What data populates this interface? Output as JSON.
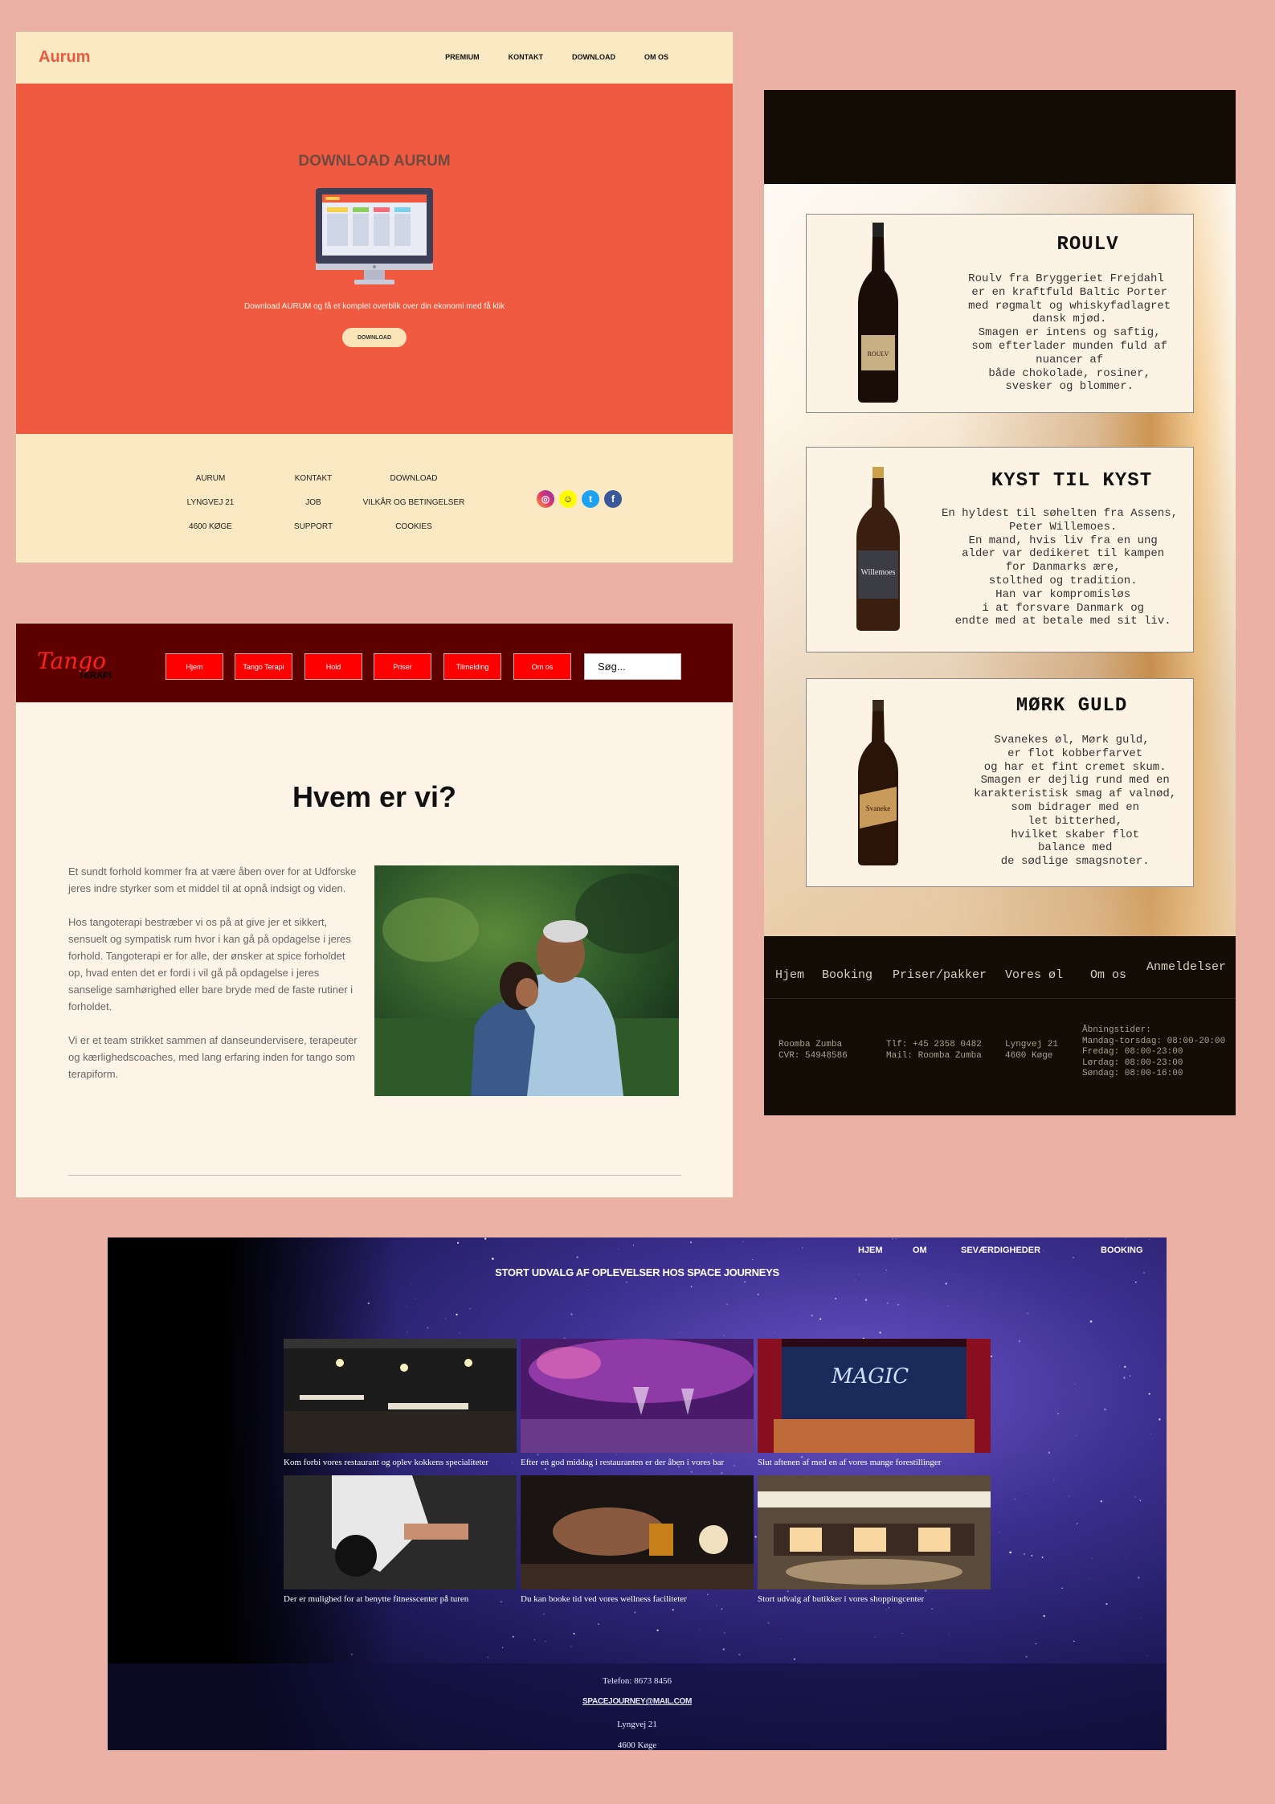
{
  "aurum": {
    "logo": "Aurum",
    "nav": [
      "PREMIUM",
      "KONTAKT",
      "DOWNLOAD",
      "OM OS"
    ],
    "hero_title": "DOWNLOAD AURUM",
    "hero_text": "Download AURUM og få et komplet overblik over din ekonomi med få klik",
    "download_button": "DOWNLOAD",
    "footer": {
      "col1": [
        "AURUM",
        "LYNGVEJ 21",
        "4600 KØGE"
      ],
      "col2": [
        "KONTAKT",
        "JOB",
        "SUPPORT"
      ],
      "col3": [
        "DOWNLOAD",
        "VILKÅR OG BETINGELSER",
        "COOKIES"
      ]
    },
    "social_icons": [
      "instagram-icon",
      "snapchat-icon",
      "twitter-icon",
      "facebook-icon"
    ],
    "colors": {
      "accent": "#ef5a40",
      "cream": "#fbe9c4"
    }
  },
  "beer": {
    "cards": [
      {
        "title": "ROULV",
        "text": "Roulv fra Bryggeriet Frejdahl\n er en kraftfuld Baltic Porter\n med røgmalt og whiskyfadlagret\n dansk mjød.\n Smagen er intens og saftig,\n som efterlader munden fuld af\n nuancer af\n både chokolade, rosiner,\n svesker og blommer."
      },
      {
        "title": "KYST TIL KYST",
        "text": "En hyldest til søhelten fra Assens,\n Peter Willemoes.\n En mand, hvis liv fra en ung\n alder var dedikeret til kampen\n for Danmarks ære,\n stolthed og tradition.\n Han var kompromisløs\n i at forsvare Danmark og\n endte med at betale med sit liv."
      },
      {
        "title": "MØRK GULD",
        "text": "Svanekes øl, Mørk guld,\n er flot kobberfarvet\n og har et fint cremet skum.\n Smagen er dejlig rund med en\n karakteristisk smag af valnød,\n som bidrager med en\n let bitterhed,\n hvilket skaber flot\n balance med\n de sødlige smagsnoter."
      }
    ],
    "bottle_labels": [
      "ROULV",
      "Willemoes",
      "Svaneke"
    ],
    "nav": [
      "Hjem",
      "Booking",
      "Priser/pakker",
      "Vores øl",
      "Om os",
      "Anmeldelser"
    ],
    "info": {
      "company": "Roomba Zumba\nCVR: 54948586",
      "contact": "Tlf: +45 2358 0482\nMail: Roomba Zumba",
      "address": "Lyngvej 21\n4600 Køge",
      "hours": "Åbningstider:\nMandag-torsdag: 08:00-20:00\nFredag: 08:00-23:00\nLørdag: 08:00-23:00\nSøndag: 08:00-16:00"
    }
  },
  "tango": {
    "logo_main": "Tango",
    "logo_sub": "TERAPI",
    "nav": [
      "Hjem",
      "Tango Terapi",
      "Hold",
      "Priser",
      "Tilmelding",
      "Om os"
    ],
    "search_placeholder": "Søg...",
    "heading": "Hvem er vi?",
    "paragraphs": [
      "Et sundt forhold kommer fra at være åben over for at Udforske jeres indre styrker som et middel til at opnå indsigt og viden.",
      "Hos tangoterapi bestræber vi os på at give jer et sikkert, sensuelt og sympatisk rum hvor i kan gå på opdagelse i jeres forhold. Tangoterapi er for alle, der ønsker at spice forholdet op, hvad enten det er fordi i vil gå på opdagelse i jeres sanselige samhørighed eller bare bryde med de faste rutiner i forholdet.",
      "Vi er et team strikket sammen af danseundervisere, terapeuter og kærlighedscoaches, med lang erfaring inden for tango som terapiform."
    ]
  },
  "space": {
    "nav": [
      "HJEM",
      "OM",
      "SEVÆRDIGHEDER",
      "BOOKING"
    ],
    "heading": "STORT UDVALG AF OPLEVELSER HOS SPACE JOURNEYS",
    "tiles": [
      "Kom forbi vores restaurant og oplev kokkens specialiteter",
      "Efter en god middag i restauranten er der åben i vores bar",
      "Slut aftenen af med en af vores mange forestillinger",
      "Der er mulighed for at benytte fitnesscenter på turen",
      "Du kan booke tid ved vores wellness faciliteter",
      "Stort udvalg af butikker i vores shoppingcenter"
    ],
    "show_sign": "MAGIC",
    "footer": {
      "phone": "Telefon: 8673 8456",
      "email": "SPACEJOURNEY@MAIL.COM",
      "street": "Lyngvej 21",
      "city": "4600 Køge"
    }
  }
}
